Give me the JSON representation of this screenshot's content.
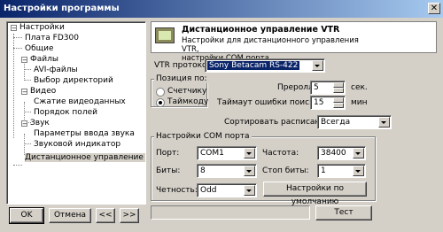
{
  "window": {
    "title": "Настройки программы",
    "close_glyph": "✕"
  },
  "tree": {
    "items": [
      {
        "label": "Настройки",
        "expander": "−"
      },
      {
        "label": "Плата FD300"
      },
      {
        "label": "Общие"
      },
      {
        "label": "Файлы",
        "expander": "−"
      },
      {
        "label": "AVI-файлы"
      },
      {
        "label": "Выбор директорий"
      },
      {
        "label": "Видео",
        "expander": "−"
      },
      {
        "label": "Сжатие видеоданных"
      },
      {
        "label": "Порядок полей"
      },
      {
        "label": "Звук",
        "expander": "−"
      },
      {
        "label": "Параметры ввода звука"
      },
      {
        "label": "Звуковой индикатор"
      },
      {
        "label": "Дистанционное управление V"
      }
    ]
  },
  "buttons": {
    "ok": "OK",
    "cancel": "Отмена",
    "prev": "<<",
    "next": ">>",
    "test": "Тест",
    "defaults": "Настройки по умолчанию"
  },
  "header": {
    "icon": "tv-icon",
    "title": "Дистанционное управление VTR",
    "desc_line1": "Настройки для дистанционного управления VTR,",
    "desc_line2": "настройки COM порта"
  },
  "vtr": {
    "protocol_label": "VTR протокол:",
    "protocol_value": "Sony Betacam RS-422"
  },
  "position": {
    "group_title": "Позиция по:",
    "option_counter": "Счетчику",
    "option_timecode": "Таймкоду",
    "selected": "timecode"
  },
  "preroll": {
    "label": "Преролл:",
    "value": "5",
    "unit": "сек."
  },
  "timeout": {
    "label": "Таймаут ошибки поиска:",
    "value": "15",
    "unit": "мин"
  },
  "sort": {
    "label": "Сортировать расписание:",
    "value": "Всегда"
  },
  "com": {
    "group_title": "Настройки COM порта",
    "port_label": "Порт:",
    "port_value": "COM1",
    "bits_label": "Биты:",
    "bits_value": "8",
    "parity_label": "Четность:",
    "parity_value": "Odd",
    "freq_label": "Частота:",
    "freq_value": "38400",
    "stop_label": "Стоп биты:",
    "stop_value": "1"
  },
  "colors": {
    "title_start": "#0a246a",
    "title_end": "#a6caf0",
    "face": "#d4d0c8"
  }
}
